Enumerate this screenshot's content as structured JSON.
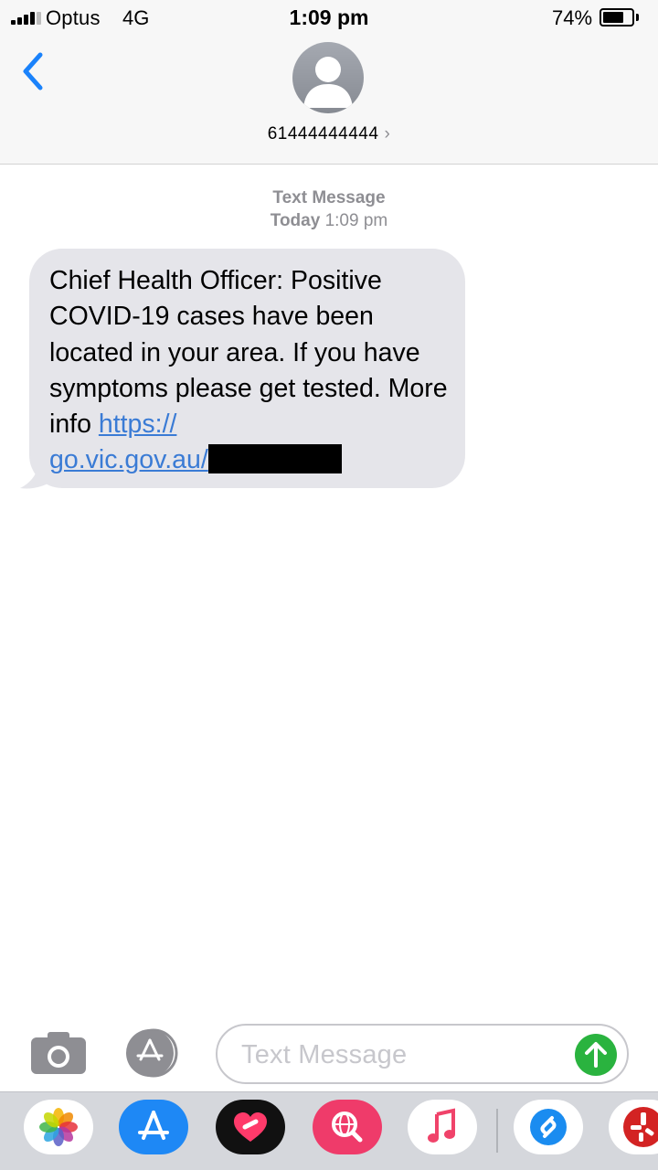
{
  "status_bar": {
    "carrier": "Optus",
    "network": "4G",
    "time": "1:09 pm",
    "battery_percent": "74%",
    "battery_level": 0.74
  },
  "header": {
    "contact": "61444444444",
    "chevron": "›",
    "back_icon": "chevron-left-icon",
    "avatar_icon": "person-silhouette-icon"
  },
  "conversation": {
    "type_label": "Text Message",
    "date_label": "Today",
    "time_label": "1:09 pm",
    "message": {
      "text": "Chief Health Officer: Positive COVID-19 cases have been located in your area. If you have symptoms please get tested. More info ",
      "link_line1": "https://",
      "link_line2": "go.vic.gov.au/"
    }
  },
  "input_bar": {
    "placeholder": "Text Message",
    "camera_icon": "camera-icon",
    "apps_icon": "app-store-icon",
    "send_icon": "send-arrow-icon"
  },
  "app_strip": {
    "apps": [
      "photos-app-icon",
      "app-store-app-icon",
      "digital-touch-app-icon",
      "web-search-app-icon",
      "music-app-icon",
      "shazam-app-icon",
      "yelp-app-icon"
    ]
  },
  "colors": {
    "link": "#3a7bd5",
    "bubble": "#e5e5ea",
    "ios_blue": "#1a82fb",
    "send_green": "#2ab33f",
    "muted": "#8e8e93"
  }
}
